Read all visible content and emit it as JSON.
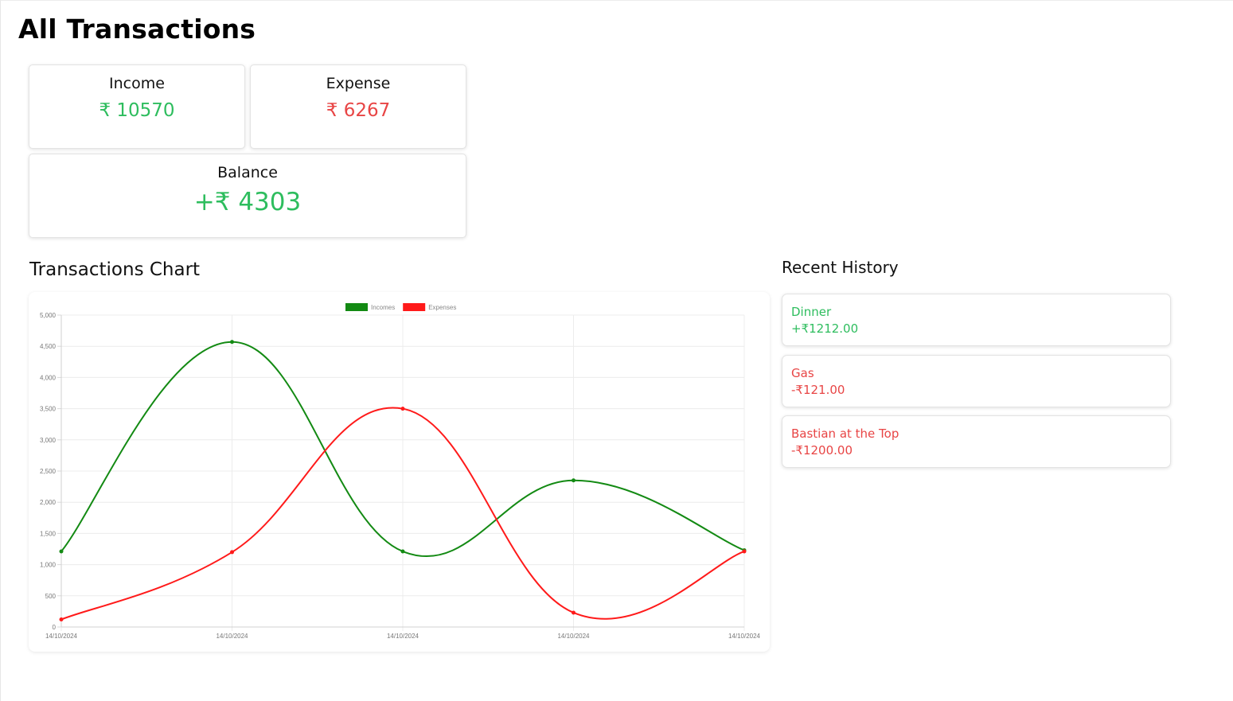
{
  "page": {
    "title": "All Transactions"
  },
  "summary": {
    "income": {
      "label": "Income",
      "value": "₹ 10570"
    },
    "expense": {
      "label": "Expense",
      "value": "₹ 6267"
    },
    "balance": {
      "label": "Balance",
      "value": "+₹ 4303"
    }
  },
  "colors": {
    "positive": "#2ebd5e",
    "negative": "#e84545",
    "income_line": "#138a13",
    "expense_line": "#ff1a1a"
  },
  "chart_section": {
    "title": "Transactions Chart"
  },
  "chart_data": {
    "type": "line",
    "categories": [
      "14/10/2024",
      "14/10/2024",
      "14/10/2024",
      "14/10/2024",
      "14/10/2024"
    ],
    "series": [
      {
        "name": "Incomes",
        "color": "#138a13",
        "values": [
          1212,
          4570,
          1212,
          2350,
          1230
        ]
      },
      {
        "name": "Expenses",
        "color": "#ff1a1a",
        "values": [
          121,
          1200,
          3500,
          230,
          1212
        ]
      }
    ],
    "yticks": [
      "0",
      "500",
      "1,000",
      "1,500",
      "2,000",
      "2,500",
      "3,000",
      "3,500",
      "4,000",
      "4,500",
      "5,000"
    ],
    "ylim": [
      0,
      5000
    ],
    "grid": true,
    "legend_position": "top-center"
  },
  "history": {
    "title": "Recent History",
    "items": [
      {
        "name": "Dinner",
        "amount": "+₹1212.00",
        "type": "income"
      },
      {
        "name": "Gas",
        "amount": "-₹121.00",
        "type": "expense"
      },
      {
        "name": "Bastian at the Top",
        "amount": "-₹1200.00",
        "type": "expense"
      }
    ]
  }
}
